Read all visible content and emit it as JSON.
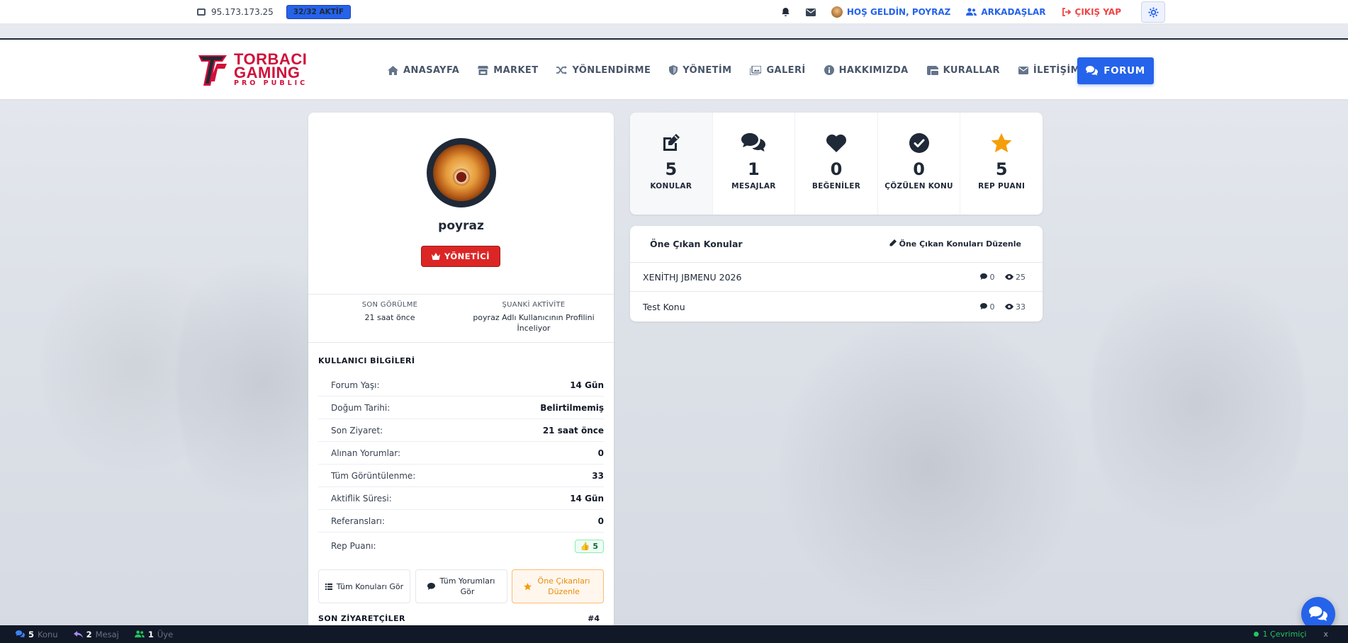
{
  "topbar": {
    "ip": "95.173.173.25",
    "active_badge": "32/32 AKTİF",
    "welcome": "HOŞ GELDİN, POYRAZ",
    "friends": "ARKADAŞLAR",
    "logout": "ÇIKIŞ YAP"
  },
  "logo": {
    "line1": "TORBACI",
    "line2": "GAMING",
    "line3": "PRO PUBLIC"
  },
  "nav": {
    "items": [
      {
        "label": "ANASAYFA",
        "icon": "home-icon"
      },
      {
        "label": "MARKET",
        "icon": "store-icon"
      },
      {
        "label": "YÖNLENDİRME",
        "icon": "shuffle-icon"
      },
      {
        "label": "YÖNETİM",
        "icon": "shield-icon"
      },
      {
        "label": "GALERİ",
        "icon": "images-icon"
      },
      {
        "label": "HAKKIMIZDA",
        "icon": "info-icon"
      },
      {
        "label": "KURALLAR",
        "icon": "rules-icon"
      },
      {
        "label": "İLETİŞİM",
        "icon": "envelope-icon"
      }
    ],
    "forum_button": "FORUM"
  },
  "profile": {
    "username": "poyraz",
    "role": "YÖNETİCİ",
    "last_seen_label": "SON GÖRÜLME",
    "last_seen_value": "21 saat önce",
    "activity_label": "ŞUANKİ AKTİVİTE",
    "activity_value": "poyraz Adlı Kullanıcının Profilini İnceliyor",
    "info_title": "KULLANICI BİLGİLERİ",
    "info": [
      {
        "key": "Forum Yaşı:",
        "value": "14 Gün"
      },
      {
        "key": "Doğum Tarihi:",
        "value": "Belirtilmemiş"
      },
      {
        "key": "Son Ziyaret:",
        "value": "21 saat önce"
      },
      {
        "key": "Alınan Yorumlar:",
        "value": "0"
      },
      {
        "key": "Tüm Görüntülenme:",
        "value": "33"
      },
      {
        "key": "Aktiflik Süresi:",
        "value": "14 Gün"
      },
      {
        "key": "Referansları:",
        "value": "0"
      }
    ],
    "rep_label": "Rep Puanı:",
    "rep_value": "5",
    "buttons": {
      "all_topics": "Tüm Konuları Gör",
      "all_comments": "Tüm Yorumları Gör",
      "edit_featured": "Öne Çıkanları Düzenle"
    },
    "visitors_title": "SON ZİYARETÇİLER",
    "visitors_count": "#4"
  },
  "stats": [
    {
      "value": "5",
      "label": "KONULAR",
      "icon": "edit-icon"
    },
    {
      "value": "1",
      "label": "MESAJLAR",
      "icon": "comments-icon"
    },
    {
      "value": "0",
      "label": "BEĞENİLER",
      "icon": "heart-icon"
    },
    {
      "value": "0",
      "label": "ÇÖZÜLEN KONU",
      "icon": "check-circle-icon"
    },
    {
      "value": "5",
      "label": "REP PUANI",
      "icon": "star-icon"
    }
  ],
  "featured": {
    "title": "Öne Çıkan Konular",
    "edit_label": "Öne Çıkan Konuları Düzenle",
    "topics": [
      {
        "title": "XENİTHJ JBMENU 2026",
        "comments": "0",
        "views": "25"
      },
      {
        "title": "Test Konu",
        "comments": "0",
        "views": "33"
      }
    ]
  },
  "footer": {
    "topics_count": "5",
    "topics_label": "Konu",
    "messages_count": "2",
    "messages_label": "Mesaj",
    "members_count": "1",
    "members_label": "Üye",
    "online": "1 Çevrimiçi",
    "close": "x"
  },
  "colors": {
    "accent": "#2563eb",
    "brand_red": "#d0103a",
    "role_red": "#dc2626",
    "star": "#f59e0b"
  }
}
